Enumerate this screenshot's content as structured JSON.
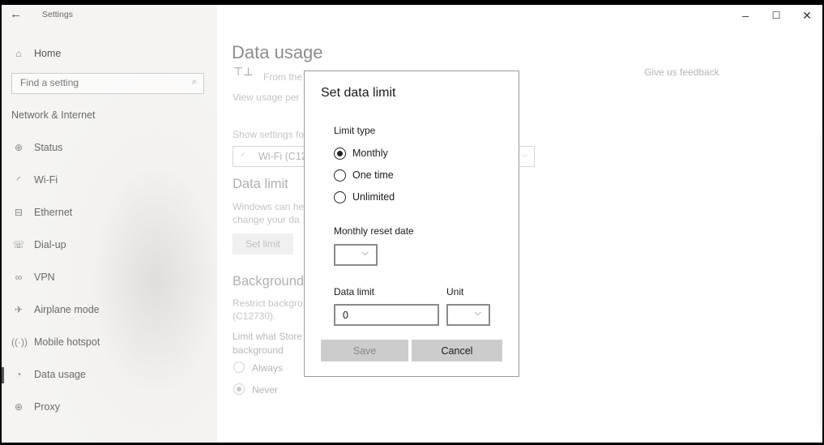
{
  "window": {
    "title": "Settings",
    "back_icon": "back-arrow-icon"
  },
  "controls": {
    "minimize": "–",
    "maximize": "☐",
    "close": "✕"
  },
  "sidebar": {
    "home": "Home",
    "search_placeholder": "Find a setting",
    "section": "Network & Internet",
    "items": [
      {
        "label": "Status",
        "icon": "globe-icon"
      },
      {
        "label": "Wi-Fi",
        "icon": "wifi-icon"
      },
      {
        "label": "Ethernet",
        "icon": "ethernet-icon"
      },
      {
        "label": "Dial-up",
        "icon": "dialup-icon"
      },
      {
        "label": "VPN",
        "icon": "vpn-icon"
      },
      {
        "label": "Airplane mode",
        "icon": "airplane-icon"
      },
      {
        "label": "Mobile hotspot",
        "icon": "hotspot-icon"
      },
      {
        "label": "Data usage",
        "icon": "data-usage-icon"
      },
      {
        "label": "Proxy",
        "icon": "proxy-icon"
      }
    ],
    "active": "Data usage"
  },
  "main": {
    "title": "Data usage",
    "from_text": "From the",
    "view_text": "View usage per",
    "show_settings": "Show settings fo",
    "network_value": "Wi-Fi (C12",
    "data_limit_heading": "Data limit",
    "desc_line1": "Windows can he",
    "desc_line2": "change your da",
    "set_limit": "Set limit",
    "background_heading": "Background",
    "restrict_line1": "Restrict backgro",
    "restrict_line2": "(C12730).",
    "limit_line1": "Limit what Store",
    "limit_line2": "background",
    "radio_always": "Always",
    "radio_never": "Never",
    "feedback": "Give us feedback"
  },
  "dialog": {
    "title": "Set data limit",
    "limit_type_label": "Limit type",
    "options": [
      "Monthly",
      "One time",
      "Unlimited"
    ],
    "selected": "Monthly",
    "reset_date_label": "Monthly reset date",
    "reset_date_value": "",
    "data_limit_label": "Data limit",
    "data_limit_value": "0",
    "unit_label": "Unit",
    "unit_value": "",
    "save": "Save",
    "cancel": "Cancel"
  }
}
